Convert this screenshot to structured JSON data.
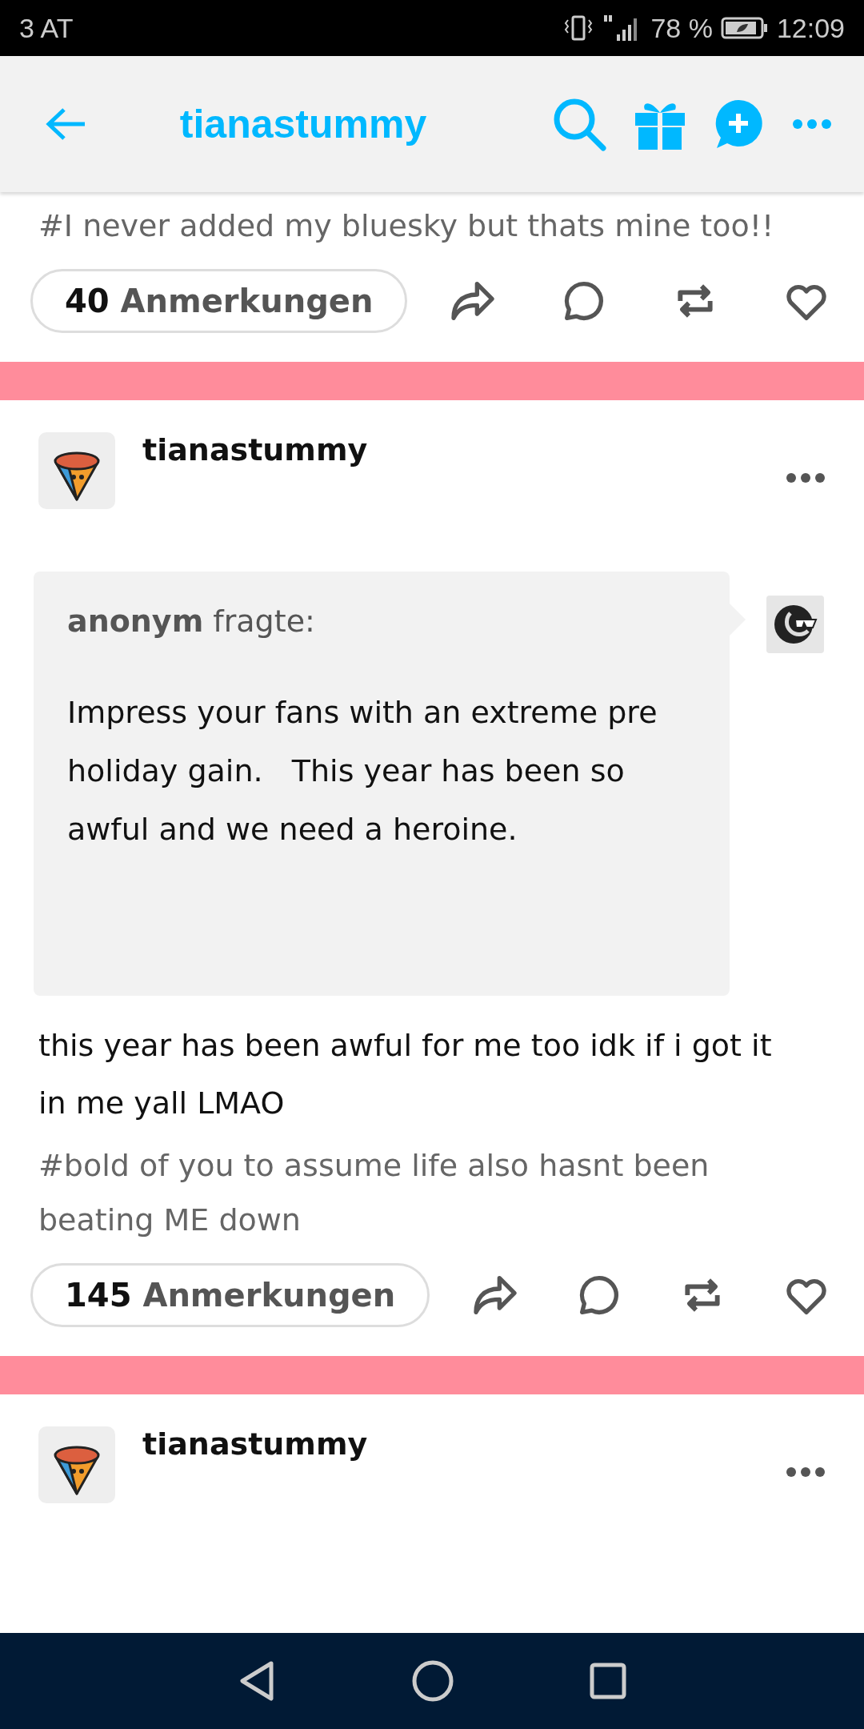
{
  "status_bar": {
    "carrier": "3 AT",
    "battery": "78 %",
    "time": "12:09"
  },
  "header": {
    "title": "tianastummy"
  },
  "posts": [
    {
      "kind": "tail",
      "tags": "#I never added my bluesky but thats mine too!!",
      "notes_count": "40",
      "notes_label": "Anmerkungen"
    },
    {
      "kind": "full",
      "author": "tianastummy",
      "ask": {
        "asker": "anonym",
        "verb": "fragte:",
        "question": "Impress your fans with an extreme pre holiday gain.   This year has been so awful and we need a heroine."
      },
      "answer": "this year has been awful for me too idk if i got it in me yall LMAO",
      "tags": "#bold of you to assume life also hasnt been beating ME down",
      "notes_count": "145",
      "notes_label": "Anmerkungen"
    },
    {
      "kind": "head",
      "author": "tianastummy"
    }
  ]
}
